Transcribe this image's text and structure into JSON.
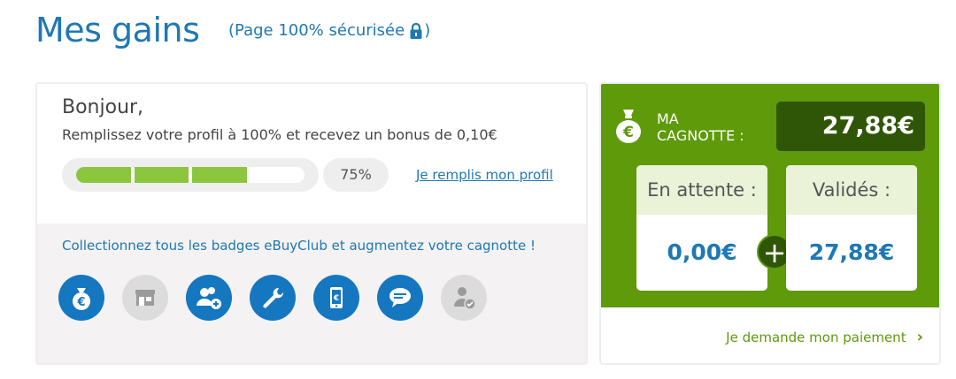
{
  "header": {
    "title": "Mes gains",
    "secure_prefix": "(Page 100% sécurisée",
    "secure_suffix": ")"
  },
  "profile": {
    "greeting": "Bonjour,",
    "message": "Remplissez votre profil à 100% et recevez un bonus de 0,10€",
    "progress_percent": 75,
    "progress_label": "75%",
    "progress_segments_filled": 3,
    "progress_segments_total": 4,
    "link_label": "Je remplis mon profil"
  },
  "badges": {
    "message": "Collectionnez tous les badges eBuyClub et augmentez votre cagnotte !",
    "items": [
      {
        "name": "money-bag-badge",
        "active": true
      },
      {
        "name": "shop-badge",
        "active": false
      },
      {
        "name": "invite-friends-badge",
        "active": true
      },
      {
        "name": "tools-badge",
        "active": true
      },
      {
        "name": "mobile-badge",
        "active": true
      },
      {
        "name": "chat-badge",
        "active": true
      },
      {
        "name": "verified-user-badge",
        "active": false
      }
    ]
  },
  "wallet": {
    "label_line1": "MA",
    "label_line2": "CAGNOTTE :",
    "total": "27,88€",
    "pending_label": "En attente :",
    "pending_value": "0,00€",
    "plus_symbol": "+",
    "validated_label": "Validés :",
    "validated_value": "27,88€",
    "payment_link": "Je demande mon paiement",
    "chevron": "›"
  },
  "colors": {
    "accent_blue": "#1e78b4",
    "wallet_green": "#5e9a0a",
    "wallet_dark_green": "#2f5606",
    "progress_green": "#8cc63f"
  }
}
